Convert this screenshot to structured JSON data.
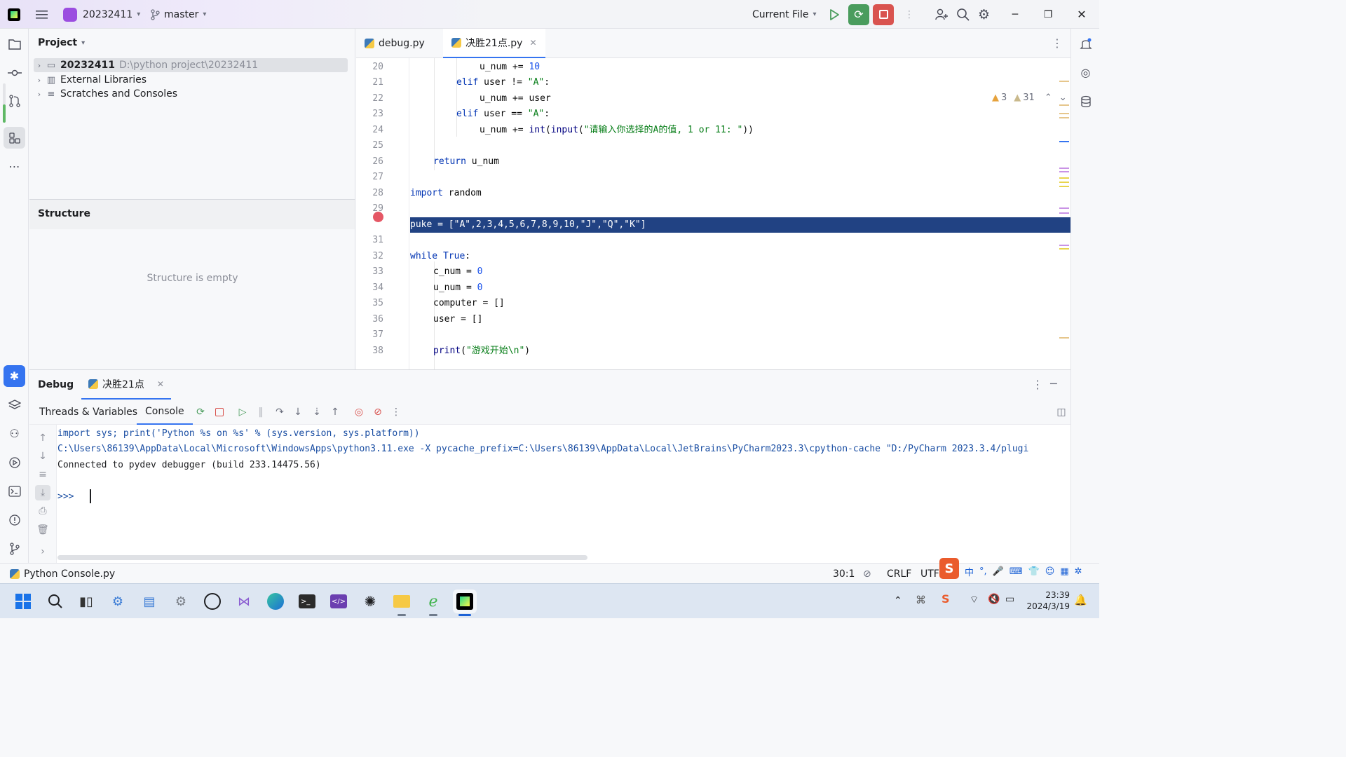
{
  "titlebar": {
    "project_name": "20232411",
    "branch": "master",
    "run_config": "Current File"
  },
  "project_panel": {
    "title": "Project",
    "tree": [
      {
        "label": "20232411",
        "path": "D:\\python project\\20232411"
      },
      {
        "label": "External Libraries"
      },
      {
        "label": "Scratches and Consoles"
      }
    ]
  },
  "structure_panel": {
    "title": "Structure",
    "empty_text": "Structure is empty"
  },
  "editor": {
    "tabs": [
      {
        "label": "debug.py"
      },
      {
        "label": "决胜21点.py"
      }
    ],
    "warnings": {
      "warn_count": "3",
      "weak_count": "31"
    },
    "lines": [
      {
        "n": "20",
        "text": "            u_num += 10"
      },
      {
        "n": "21",
        "text": "        elif user != \"A\":"
      },
      {
        "n": "22",
        "text": "            u_num += user"
      },
      {
        "n": "23",
        "text": "        elif user == \"A\":"
      },
      {
        "n": "24",
        "text": "            u_num += int(input(\"请输入你选择的A的值, 1 or 11: \"))"
      },
      {
        "n": "25",
        "text": ""
      },
      {
        "n": "26",
        "text": "    return u_num"
      },
      {
        "n": "27",
        "text": ""
      },
      {
        "n": "28",
        "text": "import random"
      },
      {
        "n": "29",
        "text": ""
      },
      {
        "n": "30",
        "text": "puke = [\"A\",2,3,4,5,6,7,8,9,10,\"J\",\"Q\",\"K\"]"
      },
      {
        "n": "31",
        "text": ""
      },
      {
        "n": "32",
        "text": "while True:"
      },
      {
        "n": "33",
        "text": "    c_num = 0"
      },
      {
        "n": "34",
        "text": "    u_num = 0"
      },
      {
        "n": "35",
        "text": "    computer = []"
      },
      {
        "n": "36",
        "text": "    user = []"
      },
      {
        "n": "37",
        "text": ""
      },
      {
        "n": "38",
        "text": "    print(\"游戏开始\\n\")"
      }
    ]
  },
  "debug_panel": {
    "title": "Debug",
    "session_tab": "决胜21点",
    "tabs": [
      "Threads & Variables",
      "Console"
    ],
    "console_lines": [
      "import sys; print('Python %s on %s' % (sys.version, sys.platform))",
      "C:\\Users\\86139\\AppData\\Local\\Microsoft\\WindowsApps\\python3.11.exe -X pycache_prefix=C:\\Users\\86139\\AppData\\Local\\JetBrains\\PyCharm2023.3\\cpython-cache \"D:/PyCharm 2023.3.4/plugi",
      "Connected to pydev debugger (build 233.14475.56)",
      "",
      ">>> "
    ]
  },
  "statusbar": {
    "file": "Python Console.py",
    "position": "30:1",
    "line_ending": "CRLF",
    "encoding": "UTF"
  },
  "taskbar": {
    "time": "23:39",
    "date": "2024/3/19",
    "ime": "中"
  },
  "colors": {
    "accent": "#3574f0",
    "selection": "#214283",
    "breakpoint": "#e55765",
    "run_green": "#4a9c5d",
    "stop_red": "#d9534f"
  }
}
